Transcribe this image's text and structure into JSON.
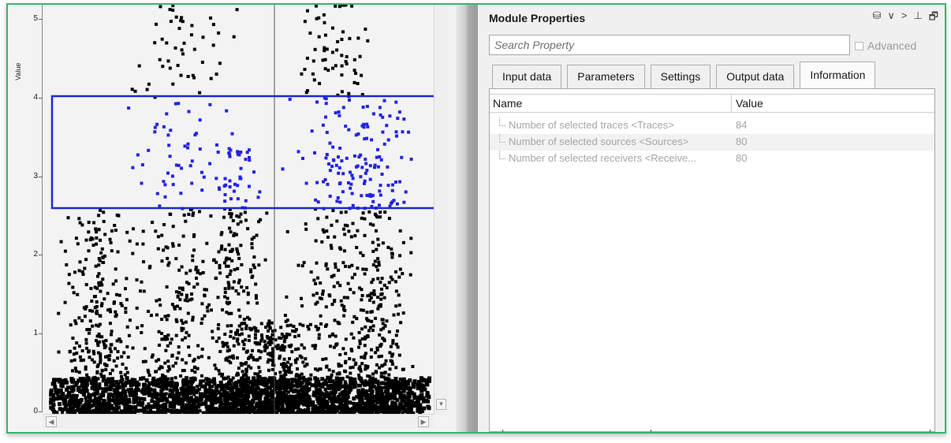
{
  "plot": {
    "y_axis_label": "Value",
    "y_ticks": [
      "0",
      "1",
      "2",
      "3",
      "4",
      "5"
    ],
    "selection_color": "#1f28d6",
    "point_color": "#000000",
    "selected_point_color": "#2424e0",
    "selection_range": {
      "y_min": 2.6,
      "y_max": 4.02
    }
  },
  "scrollbars": {
    "up_arrow": "▲",
    "down_arrow": "▼",
    "left_arrow": "◀",
    "right_arrow": "▶"
  },
  "properties": {
    "title": "Module Properties",
    "title_icons": [
      "database-lock-icon",
      "chevron-down-icon",
      "chevron-right-icon",
      "pin-icon",
      "restore-window-icon"
    ],
    "title_icon_glyphs": [
      "⛁",
      "∨",
      ">",
      "⊥",
      "🗗"
    ],
    "search_placeholder": "Search Property",
    "advanced_label": "Advanced",
    "tabs": [
      {
        "label": "Input data"
      },
      {
        "label": "Parameters"
      },
      {
        "label": "Settings"
      },
      {
        "label": "Output data"
      },
      {
        "label": "Information"
      }
    ],
    "active_tab": "Information",
    "columns": {
      "name": "Name",
      "value": "Value"
    },
    "rows": [
      {
        "name": "Number of selected traces <Traces>",
        "value": "84"
      },
      {
        "name": "Number of selected sources <Sources>",
        "value": "80"
      },
      {
        "name": "Number of selected receivers <Receive...",
        "value": "80"
      }
    ]
  },
  "colors": {
    "frame_border": "#3cb371",
    "accent_selection": "#1f28d6"
  }
}
